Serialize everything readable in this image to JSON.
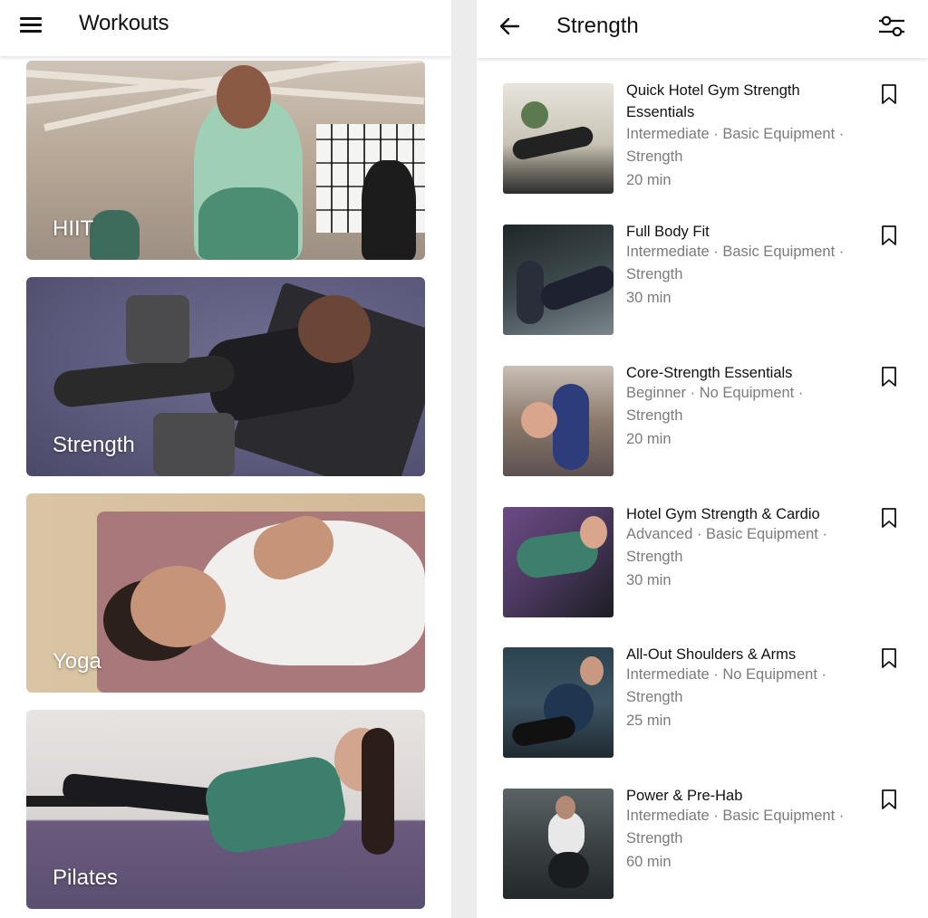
{
  "left": {
    "header": {
      "title": "Workouts",
      "menu_icon": "hamburger-menu-icon"
    },
    "categories": [
      {
        "label": "HIIT"
      },
      {
        "label": "Strength"
      },
      {
        "label": "Yoga"
      },
      {
        "label": "Pilates"
      }
    ]
  },
  "right": {
    "header": {
      "title": "Strength",
      "back_icon": "arrow-left-icon",
      "filter_icon": "sliders-filter-icon"
    },
    "workouts": [
      {
        "title": "Quick Hotel Gym Strength Essentials",
        "meta": "Intermediate · Basic Equipment · Strength",
        "duration": "20 min"
      },
      {
        "title": "Full Body Fit",
        "meta": "Intermediate · Basic Equipment · Strength",
        "duration": "30 min"
      },
      {
        "title": "Core-Strength Essentials",
        "meta": "Beginner · No Equipment · Strength",
        "duration": "20 min"
      },
      {
        "title": "Hotel Gym Strength & Cardio",
        "meta": "Advanced · Basic Equipment · Strength",
        "duration": "30 min"
      },
      {
        "title": "All-Out Shoulders & Arms",
        "meta": "Intermediate · No Equipment · Strength",
        "duration": "25 min"
      },
      {
        "title": "Power & Pre-Hab",
        "meta": "Intermediate · Basic Equipment · Strength",
        "duration": "60 min"
      }
    ]
  }
}
